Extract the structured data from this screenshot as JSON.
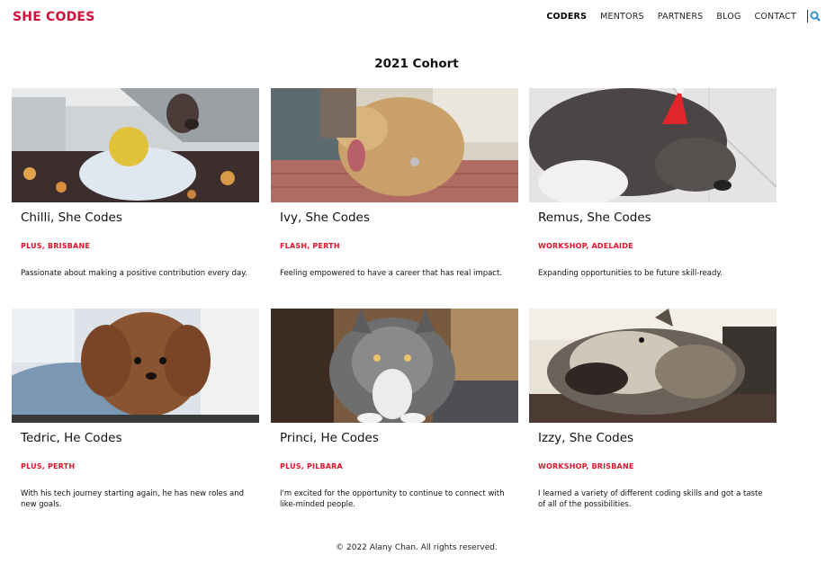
{
  "header": {
    "brand": "SHE CODES",
    "nav": [
      "CODERS",
      "MENTORS",
      "PARTNERS",
      "BLOG",
      "CONTACT"
    ],
    "active_nav": "CODERS"
  },
  "main": {
    "title": "2021 Cohort",
    "cards": [
      {
        "name": "Chilli, She Codes",
        "tag": "PLUS, BRISBANE",
        "description": "Passionate about making a positive contribution every day.",
        "photo": "chihuahua-dog-in-hoodie"
      },
      {
        "name": "Ivy, She Codes",
        "tag": "FLASH, PERTH",
        "description": "Feeling empowered to have a career that has real impact.",
        "photo": "golden-retriever-dog"
      },
      {
        "name": "Remus, She Codes",
        "tag": "WORKSHOP, ADELAIDE",
        "description": "Expanding opportunities to be future skill-ready.",
        "photo": "grey-dog-with-party-hat"
      },
      {
        "name": "Tedric, He Codes",
        "tag": "PLUS, PERTH",
        "description": "With his tech journey starting again, he has new roles and new goals.",
        "photo": "brown-poodle-dog"
      },
      {
        "name": "Princi, He Codes",
        "tag": "PLUS, PILBARA",
        "description": "I'm excited for the opportunity to continue to connect with like-minded people.",
        "photo": "fluffy-tabby-cat"
      },
      {
        "name": "Izzy, She Codes",
        "tag": "WORKSHOP, BRISBANE",
        "description": "I learned a variety of different coding skills and got a taste of all of the possibilities.",
        "photo": "schnauzer-dog-on-couch"
      }
    ]
  },
  "footer": {
    "text": "© 2022 Alany Chan. All rights reserved."
  },
  "colors": {
    "brand": "#d0103a",
    "tag": "#e3122a",
    "search_icon": "#2a86c9"
  },
  "icons": {
    "search": "search-icon"
  }
}
